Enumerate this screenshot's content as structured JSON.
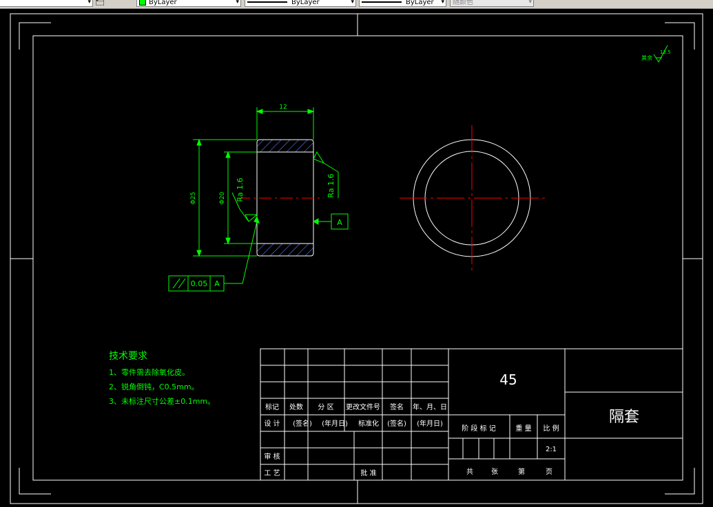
{
  "toolbar": {
    "layer_color_label": "ByLayer",
    "linetype_label": "ByLayer",
    "lineweight_label": "ByLayer",
    "plotstyle_label": "随颜色"
  },
  "drawing": {
    "roughness_general": "12.5",
    "roughness_general_note": "其余",
    "dim_width": "12",
    "dim_outer_dia": "Φ25",
    "dim_inner_dia": "Φ20",
    "ra_left": "Ra 1.6",
    "ra_right": "Ra 1.6",
    "datum_label": "A",
    "tolerance_value": "0.05",
    "tolerance_datum": "A"
  },
  "tech_req": {
    "title": "技术要求",
    "items": [
      "1、零件需去除氧化皮。",
      "2、锐角倒钝，C0.5mm。",
      "3、未标注尺寸公差±0.1mm。"
    ]
  },
  "title_block": {
    "material": "45",
    "part_name": "隔套",
    "scale": "2:1",
    "revision_headers": [
      "标记",
      "处数",
      "分 区",
      "更改文件号",
      "签名",
      "年、月、日"
    ],
    "design_row": [
      "设 计",
      "(签名)",
      "(年月日)",
      "标准化",
      "(签名)",
      "(年月日)"
    ],
    "review_label": "审 核",
    "process_label": "工 艺",
    "approve_label": "批 准",
    "stage_headers": [
      "阶 段 标 记",
      "重 量",
      "比 例"
    ],
    "sheet_row": [
      "共",
      "张",
      "第",
      "页"
    ]
  },
  "colors": {
    "background": "#000000",
    "frame": "#ffffff",
    "annotation": "#00ff00",
    "centerline": "#ff0000",
    "hatch": "#5f7fff"
  }
}
